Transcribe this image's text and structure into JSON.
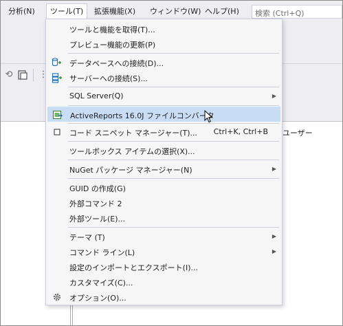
{
  "menubar": {
    "items": [
      "分析(N)",
      "ツール(T)",
      "拡張機能(X)",
      "ウィンドウ(W)",
      "ヘルプ(H)"
    ],
    "search_placeholder": "検索 (Ctrl+Q)"
  },
  "background": {
    "column_header": "ユーザー"
  },
  "menu": {
    "items": [
      {
        "label": "ツールと機能を取得(T)..."
      },
      {
        "label": "プレビュー機能の更新(P)"
      },
      {
        "label": "データベースへの接続(D)...",
        "icon": "database-connect-icon"
      },
      {
        "label": "サーバーへの接続(S)...",
        "icon": "server-connect-icon"
      },
      {
        "label": "SQL Server(Q)",
        "submenu": true
      },
      {
        "label": "ActiveReports 16.0J ファイルコンバータ",
        "icon": "activereports-converter-icon",
        "highlighted": true
      },
      {
        "label": "コード スニペット マネージャー(T)...",
        "shortcut": "Ctrl+K, Ctrl+B",
        "icon": "snippet-checkbox-icon"
      },
      {
        "label": "ツールボックス アイテムの選択(X)..."
      },
      {
        "label": "NuGet パッケージ マネージャー(N)",
        "submenu": true
      },
      {
        "label": "GUID の作成(G)"
      },
      {
        "label": "外部コマンド 2"
      },
      {
        "label": "外部ツール(E)..."
      },
      {
        "label": "テーマ (T)",
        "submenu": true
      },
      {
        "label": "コマンド ライン(L)",
        "submenu": true
      },
      {
        "label": "設定のインポートとエクスポート(I)..."
      },
      {
        "label": "カスタマイズ(C)..."
      },
      {
        "label": "オプション(O)...",
        "icon": "gear-icon"
      }
    ]
  },
  "colors": {
    "highlight": "#c9def5",
    "menu_bg": "#f6f6f6",
    "chrome_bg": "#eeeef2",
    "icon_blue": "#1e6fb6",
    "icon_green": "#388a34"
  }
}
